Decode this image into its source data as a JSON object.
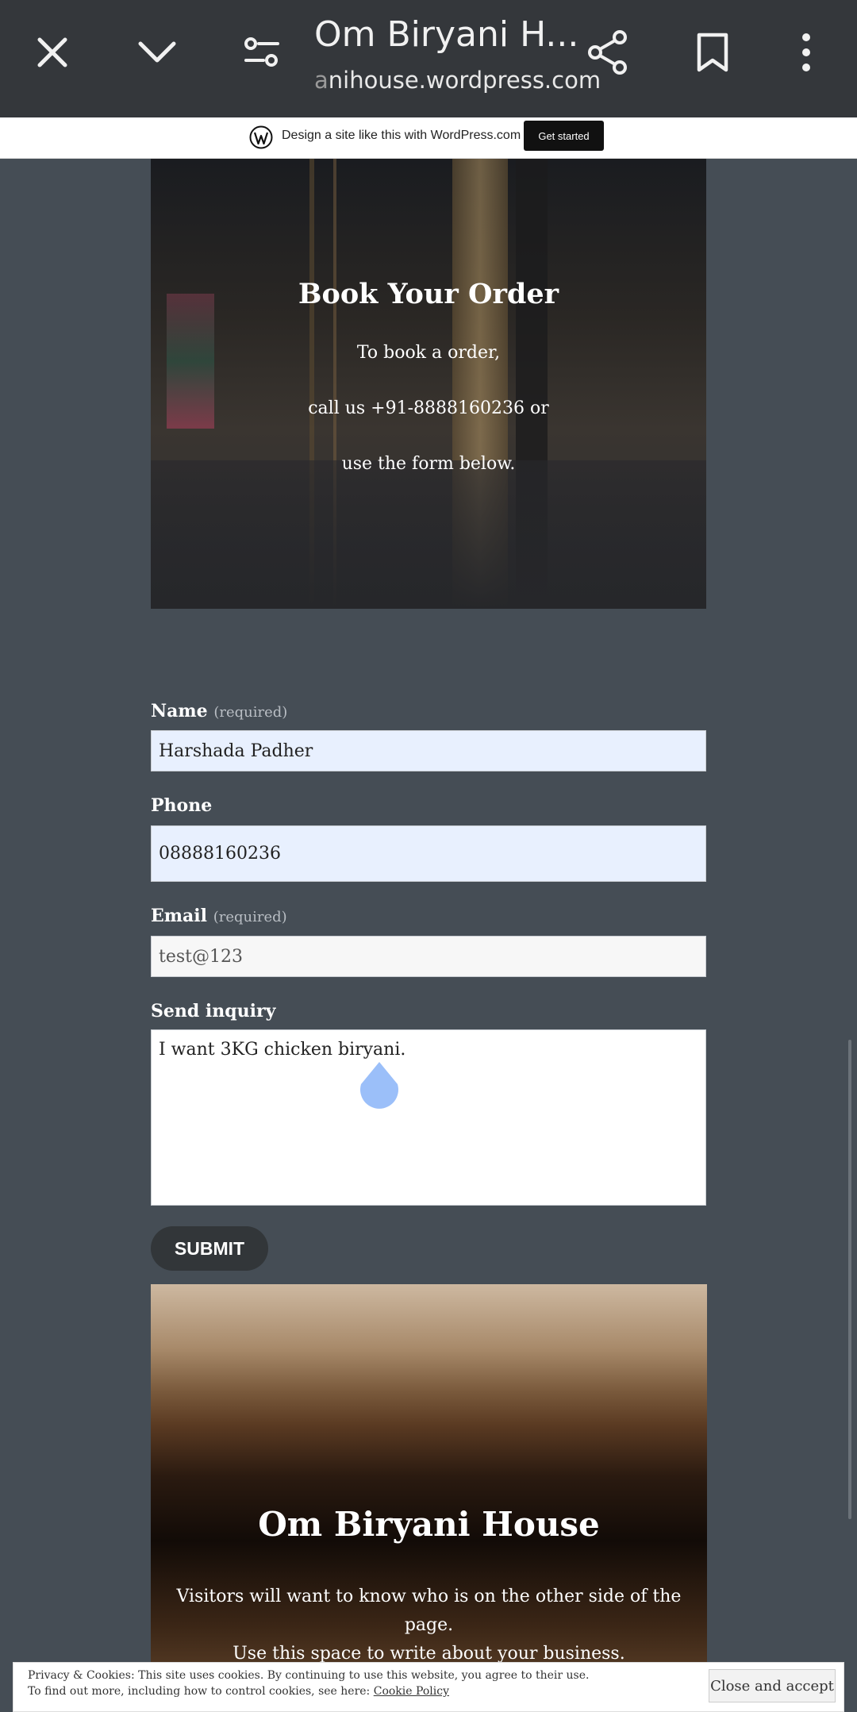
{
  "browser": {
    "title": "Om Biryani H...",
    "url_faded": "a",
    "url": "nihouse.wordpress.com",
    "icons": [
      "close-icon",
      "chevron-down-icon",
      "tune-icon",
      "share-icon",
      "bookmark-icon",
      "more-vert-icon"
    ]
  },
  "wp_banner": {
    "text": "Design a site like this with WordPress.com",
    "button": "Get started"
  },
  "hero": {
    "title": "Book Your Order",
    "line1": "To book a order,",
    "line2": "call us +91-8888160236 or",
    "line3": "use the form below."
  },
  "form": {
    "name_label": "Name",
    "name_required": "(required)",
    "name_value": "Harshada Padher",
    "phone_label": "Phone",
    "phone_value": "08888160236",
    "email_label": "Email",
    "email_required": "(required)",
    "email_value": "test@123",
    "inquiry_label": "Send inquiry",
    "inquiry_value": "I want 3KG chicken biryani.",
    "submit": "SUBMIT"
  },
  "about": {
    "title": "Om Biryani House",
    "text_line1": "Visitors will want to know who is on the other side of the page.",
    "text_line2": "Use this space to write about your business."
  },
  "cookie": {
    "line1": "Privacy & Cookies: This site uses cookies. By continuing to use this website, you agree to their use.",
    "line2": "To find out more, including how to control cookies, see here: ",
    "link": "Cookie Policy",
    "button": "Close and accept"
  },
  "colors": {
    "page_bg": "#454d55",
    "toolbar_bg": "#34373b",
    "autofill_bg": "#e8f0fe",
    "email_bg": "#f7f7f7"
  }
}
